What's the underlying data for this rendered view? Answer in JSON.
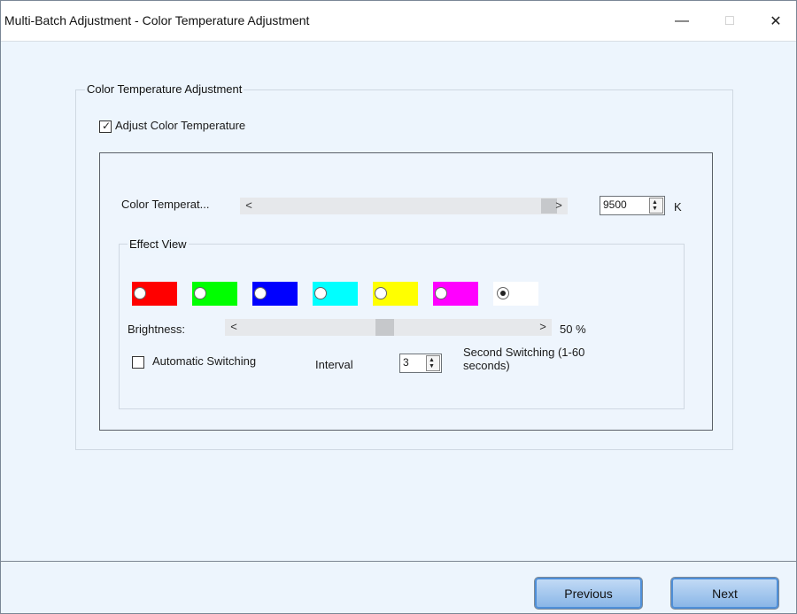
{
  "window": {
    "title": "Multi-Batch Adjustment - Color Temperature Adjustment",
    "minimize": "—",
    "maximize": "□",
    "close": "✕"
  },
  "group": {
    "title": "Color Temperature Adjustment"
  },
  "adjust": {
    "label": "Adjust Color Temperature",
    "checked": true,
    "check_mark": "✓"
  },
  "color_temp": {
    "label": "Color Temperat...",
    "left_arrow": "<",
    "right_arrow": ">",
    "value": "9500",
    "unit": "K"
  },
  "effect_view": {
    "title": "Effect View",
    "swatches": [
      {
        "color": "#ff0000",
        "selected": false
      },
      {
        "color": "#00ff00",
        "selected": false
      },
      {
        "color": "#0000ff",
        "selected": false
      },
      {
        "color": "#00ffff",
        "selected": false
      },
      {
        "color": "#ffff00",
        "selected": false
      },
      {
        "color": "#ff00ff",
        "selected": false
      },
      {
        "color": "#ffffff",
        "selected": true
      }
    ],
    "brightness_label": "Brightness:",
    "brightness_left_arrow": "<",
    "brightness_right_arrow": ">",
    "brightness_value": "50  %",
    "brightness_fraction": 0.5,
    "auto_switch_label": "Automatic Switching",
    "auto_switch_checked": false,
    "interval_label": "Interval",
    "interval_value": "3",
    "switch_text": "Second Switching (1-60 seconds)"
  },
  "footer": {
    "previous": "Previous",
    "next": "Next"
  }
}
